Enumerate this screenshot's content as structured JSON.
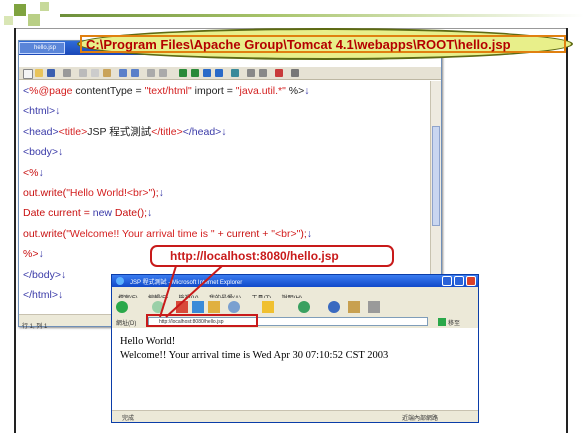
{
  "slide": {
    "path_label": "C:\\Program Files\\Apache  Group\\Tomcat 4.1\\webapps\\ROOT\\hello.jsp",
    "url_label": "http://localhost:8080/hello.jsp"
  },
  "editor": {
    "tab_title": "hello.jsp",
    "status_text": "行 1, 列 1",
    "code_lines": [
      {
        "parts": [
          {
            "t": "<",
            "c": "c-tag"
          },
          {
            "t": "%@page",
            "c": "c-str"
          },
          {
            "t": " contentType = ",
            "c": "c-blk"
          },
          {
            "t": "\"text/html\"",
            "c": "c-str"
          },
          {
            "t": " import = ",
            "c": "c-blk"
          },
          {
            "t": "\"java.util.*\"",
            "c": "c-str"
          },
          {
            "t": " %>",
            "c": "c-blk"
          },
          {
            "t": "↓",
            "c": "c-bl"
          }
        ]
      },
      {
        "parts": [
          {
            "t": "<html>",
            "c": "c-tag"
          },
          {
            "t": "↓",
            "c": "c-bl"
          }
        ]
      },
      {
        "parts": [
          {
            "t": "<head>",
            "c": "c-tag"
          },
          {
            "t": "<title>",
            "c": "c-str"
          },
          {
            "t": "JSP 程式測試",
            "c": "c-blk"
          },
          {
            "t": "</title>",
            "c": "c-str"
          },
          {
            "t": "</head>",
            "c": "c-tag"
          },
          {
            "t": "↓",
            "c": "c-bl"
          }
        ]
      },
      {
        "parts": [
          {
            "t": "<body>",
            "c": "c-tag"
          },
          {
            "t": "↓",
            "c": "c-bl"
          }
        ]
      },
      {
        "parts": [
          {
            "t": "<%",
            "c": "c-red"
          },
          {
            "t": "↓",
            "c": "c-bl"
          }
        ]
      },
      {
        "parts": [
          {
            "t": "out.write(",
            "c": "c-red"
          },
          {
            "t": "\"Hello World!<br>\"",
            "c": "c-str"
          },
          {
            "t": ");",
            "c": "c-red"
          },
          {
            "t": "↓",
            "c": "c-bl"
          }
        ]
      },
      {
        "parts": [
          {
            "t": "Date current = ",
            "c": "c-red"
          },
          {
            "t": "new",
            "c": "c-bl"
          },
          {
            "t": " Date();",
            "c": "c-red"
          },
          {
            "t": "↓",
            "c": "c-bl"
          }
        ]
      },
      {
        "parts": [
          {
            "t": "out.write(",
            "c": "c-red"
          },
          {
            "t": "\"Welcome!! Your arrival time is \"",
            "c": "c-str"
          },
          {
            "t": " + current + ",
            "c": "c-red"
          },
          {
            "t": "\"<br>\"",
            "c": "c-str"
          },
          {
            "t": ");",
            "c": "c-red"
          },
          {
            "t": "↓",
            "c": "c-bl"
          }
        ]
      },
      {
        "parts": [
          {
            "t": "%>",
            "c": "c-red"
          },
          {
            "t": "↓",
            "c": "c-bl"
          }
        ]
      },
      {
        "parts": [
          {
            "t": "</body>",
            "c": "c-tag"
          },
          {
            "t": "↓",
            "c": "c-bl"
          }
        ]
      },
      {
        "parts": [
          {
            "t": "</html>",
            "c": "c-tag"
          },
          {
            "t": "↓",
            "c": "c-bl"
          }
        ]
      }
    ]
  },
  "browser": {
    "title": "JSP 程式測試 - Microsoft Internet Explorer",
    "menu": [
      "檔案(F)",
      "編輯(E)",
      "檢視(V)",
      "我的最愛(A)",
      "工具(T)",
      "說明(H)"
    ],
    "address_label": "網址(D)",
    "address_value": "http://localhost:8080/hello.jsp",
    "go_label": "移至",
    "content_lines": [
      "Hello World!",
      "Welcome!! Your arrival time is Wed Apr 30 07:10:52 CST 2003"
    ],
    "status_done": "完成",
    "status_zone": "近端內部網路"
  }
}
